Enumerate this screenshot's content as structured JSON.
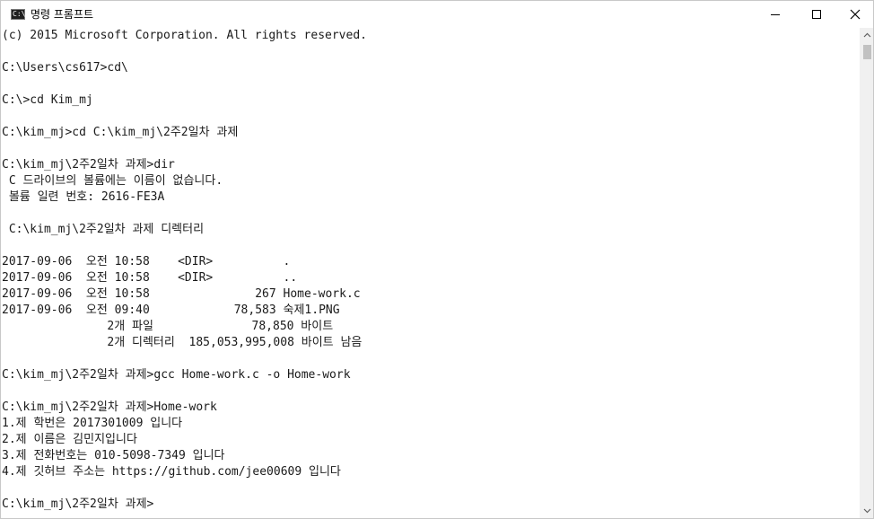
{
  "window": {
    "title": "명령 프롬프트",
    "icon": "console-icon",
    "icon_glyph": "C:\\"
  },
  "controls": {
    "minimize": "minimize-icon",
    "maximize": "maximize-icon",
    "close": "close-icon"
  },
  "console": {
    "lines": [
      "(c) 2015 Microsoft Corporation. All rights reserved.",
      "",
      "C:\\Users\\cs617>cd\\",
      "",
      "C:\\>cd Kim_mj",
      "",
      "C:\\kim_mj>cd C:\\kim_mj\\2주2일차 과제",
      "",
      "C:\\kim_mj\\2주2일차 과제>dir",
      " C 드라이브의 볼륨에는 이름이 없습니다.",
      " 볼륨 일련 번호: 2616-FE3A",
      "",
      " C:\\kim_mj\\2주2일차 과제 디렉터리",
      "",
      "2017-09-06  오전 10:58    <DIR>          .",
      "2017-09-06  오전 10:58    <DIR>          ..",
      "2017-09-06  오전 10:58               267 Home-work.c",
      "2017-09-06  오전 09:40            78,583 숙제1.PNG",
      "               2개 파일              78,850 바이트",
      "               2개 디렉터리  185,053,995,008 바이트 남음",
      "",
      "C:\\kim_mj\\2주2일차 과제>gcc Home-work.c -o Home-work",
      "",
      "C:\\kim_mj\\2주2일차 과제>Home-work",
      "1.제 학번은 2017301009 입니다",
      "2.제 이름은 김민지입니다",
      "3.제 전화번호는 010-5098-7349 입니다",
      "4.제 깃허브 주소는 https://github.com/jee00609 입니다",
      "",
      "C:\\kim_mj\\2주2일차 과제>"
    ]
  },
  "colors": {
    "background": "#ffffff",
    "text": "#1a1a1a",
    "scrollbar_track": "#f0f0f0",
    "scrollbar_thumb": "#c1c1c1"
  }
}
